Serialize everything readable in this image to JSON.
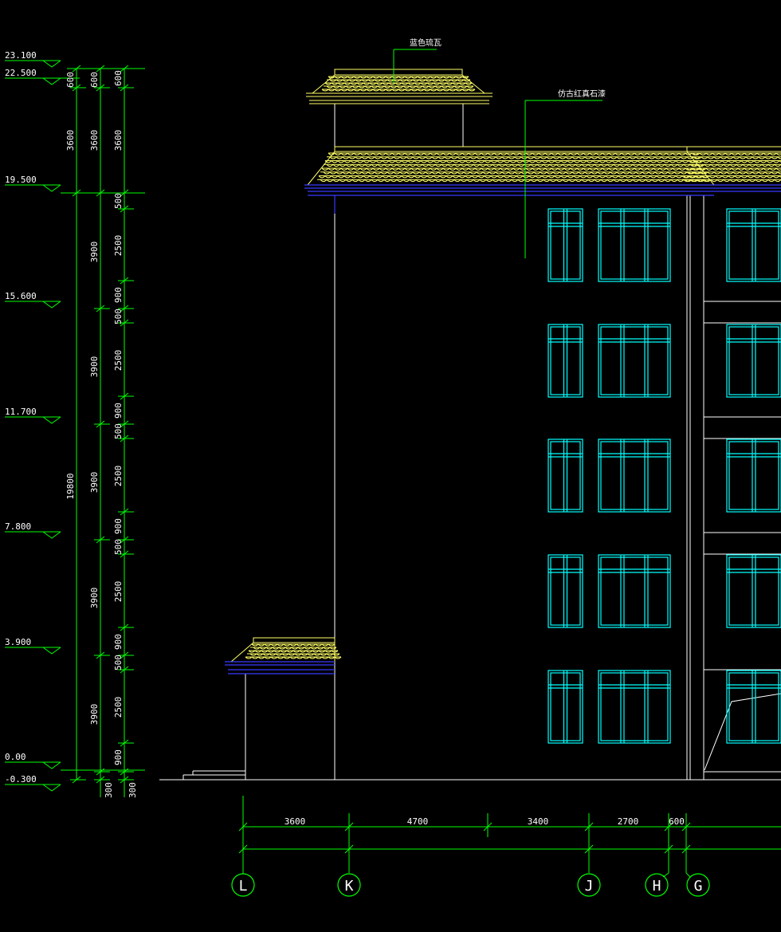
{
  "annotations": {
    "roof_tile": "蓝色琉瓦",
    "wall_finish": "仿古红真石漆"
  },
  "elevation_marks": [
    "23.100",
    "22.500",
    "19.500",
    "15.600",
    "11.700",
    "7.800",
    "3.900",
    "0.00",
    "-0.300"
  ],
  "dims_outer": {
    "top": "600",
    "upper": "3600",
    "total": "19800"
  },
  "dims_middle": [
    "600",
    "3600",
    "3900",
    "3900",
    "3900",
    "3900",
    "3900"
  ],
  "dims_inner": [
    "600",
    "3600",
    "500",
    "2500",
    "900",
    "500",
    "2500",
    "900",
    "500",
    "2500",
    "900",
    "500",
    "2500",
    "900",
    "500",
    "2500",
    "900"
  ],
  "dims_bottom_vertical": [
    "300",
    "300"
  ],
  "dims_horizontal": [
    "3600",
    "4700",
    "3400",
    "2700",
    "600"
  ],
  "axes": [
    "L",
    "K",
    "J",
    "H",
    "G"
  ],
  "colors": {
    "dimension": "#00ff00",
    "outline": "#ffffff",
    "window": "#00ffff",
    "eave": "#3a3aff",
    "tile": "#ffff66"
  }
}
